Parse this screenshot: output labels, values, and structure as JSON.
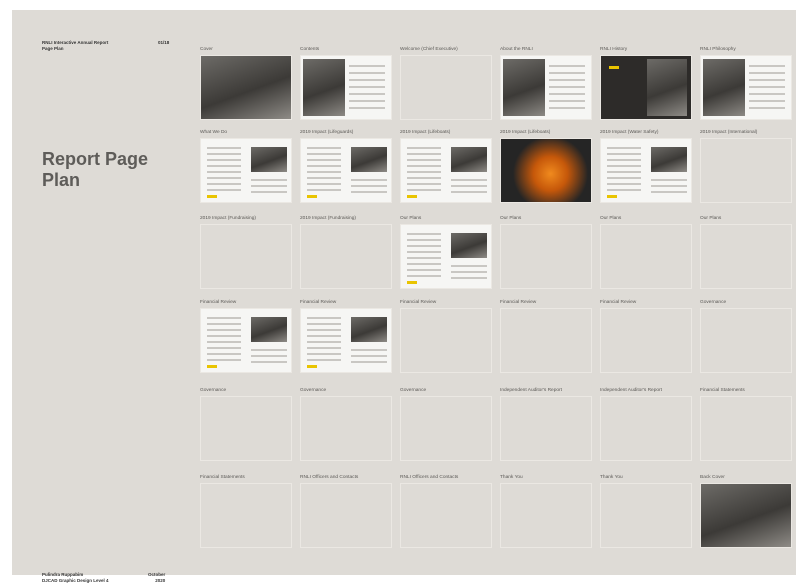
{
  "header": {
    "line1": "RNLI Interactive Annual Report",
    "line2": "Page Plan",
    "page_number": "01/18"
  },
  "page_title": {
    "line1": "Report Page",
    "line2": "Plan"
  },
  "footer": {
    "name": "Pulindra Ruppabim",
    "course": "DJCAD Graphic Design Level 4",
    "month": "October",
    "year": "2020"
  },
  "pages": [
    {
      "label": "Cover",
      "thumb": "photo"
    },
    {
      "label": "Contents",
      "thumb": "split-photo"
    },
    {
      "label": "Welcome (Chief Executive)",
      "thumb": "empty"
    },
    {
      "label": "About the RNLI",
      "thumb": "split-photo"
    },
    {
      "label": "RNLI History",
      "thumb": "dark"
    },
    {
      "label": "RNLI Philosophy",
      "thumb": "split-photo"
    },
    {
      "label": "What We Do",
      "thumb": "doc"
    },
    {
      "label": "2019 Impact (Lifeguards)",
      "thumb": "doc"
    },
    {
      "label": "2019 Impact (Lifeboats)",
      "thumb": "doc"
    },
    {
      "label": "2019 Impact (Lifeboats)",
      "thumb": "orange"
    },
    {
      "label": "2019 Impact (Water Safety)",
      "thumb": "doc"
    },
    {
      "label": "2019 Impact (International)",
      "thumb": "empty"
    },
    {
      "label": "2019 Impact (Fundraising)",
      "thumb": "empty"
    },
    {
      "label": "2019 Impact (Fundraising)",
      "thumb": "empty"
    },
    {
      "label": "Our Plans",
      "thumb": "doc"
    },
    {
      "label": "Our Plans",
      "thumb": "empty"
    },
    {
      "label": "Our Plans",
      "thumb": "empty"
    },
    {
      "label": "Our Plans",
      "thumb": "empty"
    },
    {
      "label": "Financial Review",
      "thumb": "doc"
    },
    {
      "label": "Financial Review",
      "thumb": "doc"
    },
    {
      "label": "Financial Review",
      "thumb": "empty"
    },
    {
      "label": "Financial Review",
      "thumb": "empty"
    },
    {
      "label": "Financial Review",
      "thumb": "empty"
    },
    {
      "label": "Governance",
      "thumb": "empty"
    },
    {
      "label": "Governance",
      "thumb": "empty"
    },
    {
      "label": "Governance",
      "thumb": "empty"
    },
    {
      "label": "Governance",
      "thumb": "empty"
    },
    {
      "label": "Independent Auditor's Report",
      "thumb": "empty"
    },
    {
      "label": "Independent Auditor's Report",
      "thumb": "empty"
    },
    {
      "label": "Financial Statements",
      "thumb": "empty"
    },
    {
      "label": "Financial Statements",
      "thumb": "empty"
    },
    {
      "label": "RNLI Officers and Contacts",
      "thumb": "empty"
    },
    {
      "label": "RNLI Officers and Contacts",
      "thumb": "empty"
    },
    {
      "label": "Thank You",
      "thumb": "empty"
    },
    {
      "label": "Thank You",
      "thumb": "empty"
    },
    {
      "label": "Back Cover",
      "thumb": "photo"
    }
  ]
}
